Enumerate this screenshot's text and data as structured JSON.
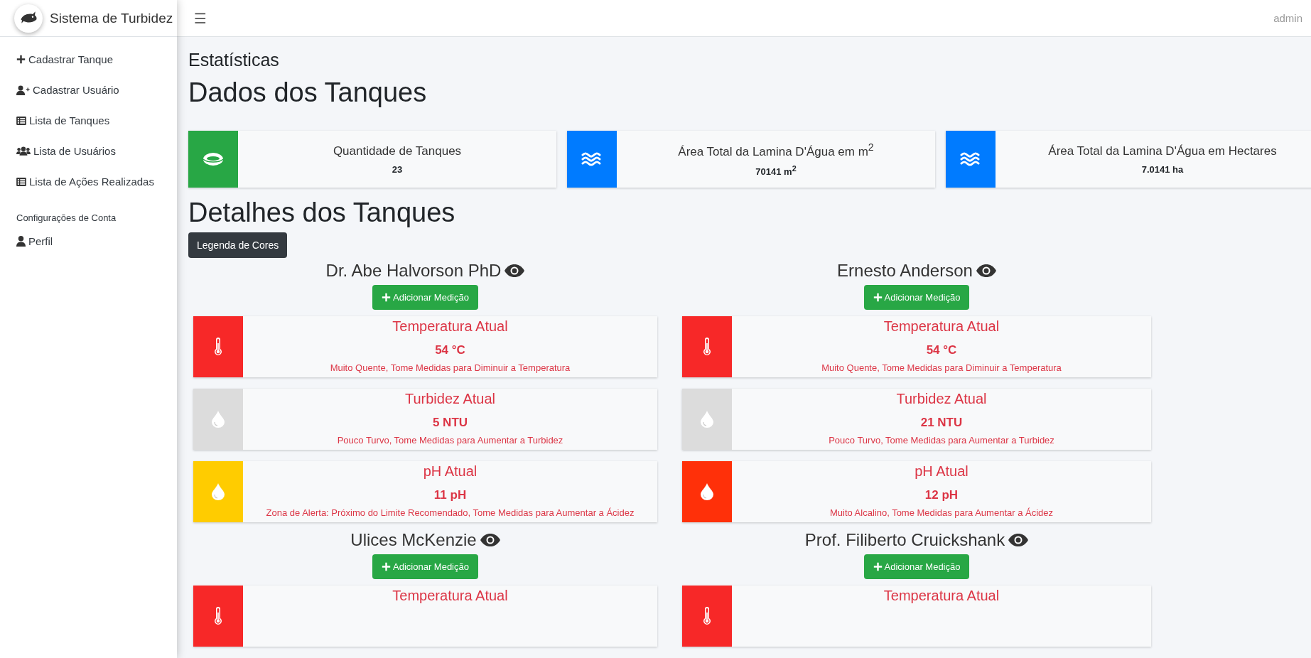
{
  "brand": {
    "title": "Sistema de Turbidez"
  },
  "topbar": {
    "menu_icon": "☰",
    "user": "admin"
  },
  "sidebar": {
    "items": [
      {
        "label": "Cadastrar Tanque",
        "kind": "plus"
      },
      {
        "label": "Cadastrar Usuário",
        "kind": "user-plus"
      },
      {
        "label": "Lista de Tanques",
        "kind": "list"
      },
      {
        "label": "Lista de Usuários",
        "kind": "users"
      },
      {
        "label": "Lista de Ações Realizadas",
        "kind": "list"
      }
    ],
    "section_title": "Configurações de Conta",
    "account_items": [
      {
        "label": "Perfil",
        "kind": "user"
      }
    ]
  },
  "page_title": "Estatísticas",
  "stats_heading": "Dados dos Tanques",
  "stats": [
    {
      "label": "Quantidade de Tanques",
      "value": "23",
      "kind": "ring",
      "color": "#28a745"
    },
    {
      "label": "Área Total da Lamina D'Água em m$^{2}$",
      "value": "70141 m$^{2}$",
      "kind": "water",
      "color": "#007bff"
    },
    {
      "label": "Área Total da Lamina D'Água em Hectares",
      "value": "7.0141 ha",
      "kind": "water",
      "color": "#007bff"
    }
  ],
  "details_heading": "Detalhes dos Tanques",
  "legend_button": "Legenda de Cores",
  "tanks": [
    {
      "name": "Dr. Abe Halvorson PhD",
      "add_button": "Adicionar Medição",
      "readings": [
        {
          "kind": "temperature",
          "title": "Temperatura Atual",
          "value": "54 °C",
          "message": "Muito Quente, Tome Medidas para Diminuir a Temperatura",
          "color": "#f72828"
        },
        {
          "kind": "drop",
          "title": "Turbidez Atual",
          "value": "5 NTU",
          "message": "Pouco Turvo, Tome Medidas para Aumentar a Turbidez",
          "color": "#dcdcdc"
        },
        {
          "kind": "drop",
          "title": "pH Atual",
          "value": "11 pH",
          "message": "Zona de Alerta: Próximo do Limite Recomendado, Tome Medidas para Aumentar a Ácidez",
          "color": "#ffcc00"
        }
      ]
    },
    {
      "name": "Ernesto Anderson",
      "add_button": "Adicionar Medição",
      "readings": [
        {
          "kind": "temperature",
          "title": "Temperatura Atual",
          "value": "54 °C",
          "message": "Muito Quente, Tome Medidas para Diminuir a Temperatura",
          "color": "#f72828"
        },
        {
          "kind": "drop",
          "title": "Turbidez Atual",
          "value": "21 NTU",
          "message": "Pouco Turvo, Tome Medidas para Aumentar a Turbidez",
          "color": "#dcdcdc"
        },
        {
          "kind": "drop",
          "title": "pH Atual",
          "value": "12 pH",
          "message": "Muito Alcalino, Tome Medidas para Aumentar a Ácidez",
          "color": "#ff3009"
        }
      ]
    },
    {
      "name": "Ulices McKenzie",
      "add_button": "Adicionar Medição",
      "readings": [
        {
          "kind": "temperature",
          "title": "Temperatura Atual",
          "color": "#f72828"
        }
      ]
    },
    {
      "name": "Prof. Filiberto Cruickshank",
      "add_button": "Adicionar Medição",
      "readings": [
        {
          "kind": "temperature",
          "title": "Temperatura Atual",
          "color": "#f72828"
        }
      ]
    }
  ]
}
